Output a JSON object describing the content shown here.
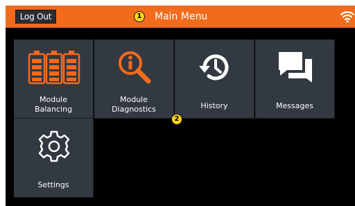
{
  "header": {
    "logout_label": "Log Out",
    "title": "Main Menu",
    "bg_color": "#f26b1d"
  },
  "callouts": [
    "1",
    "2"
  ],
  "tiles": [
    {
      "label_line1": "Module",
      "label_line2": "Balancing",
      "icon": "battery-modules-icon",
      "icon_color": "#f26b1d"
    },
    {
      "label_line1": "Module",
      "label_line2": "Diagnostics",
      "icon": "magnifier-info-icon",
      "icon_color": "#f26b1d"
    },
    {
      "label": "History",
      "icon": "history-clock-icon",
      "icon_color": "#ffffff"
    },
    {
      "label": "Messages",
      "icon": "chat-bubbles-icon",
      "icon_color": "#ffffff"
    },
    {
      "label": "Settings",
      "icon": "gear-icon",
      "icon_color": "#ffffff"
    }
  ],
  "status": {
    "wifi_icon": "wifi-icon"
  }
}
